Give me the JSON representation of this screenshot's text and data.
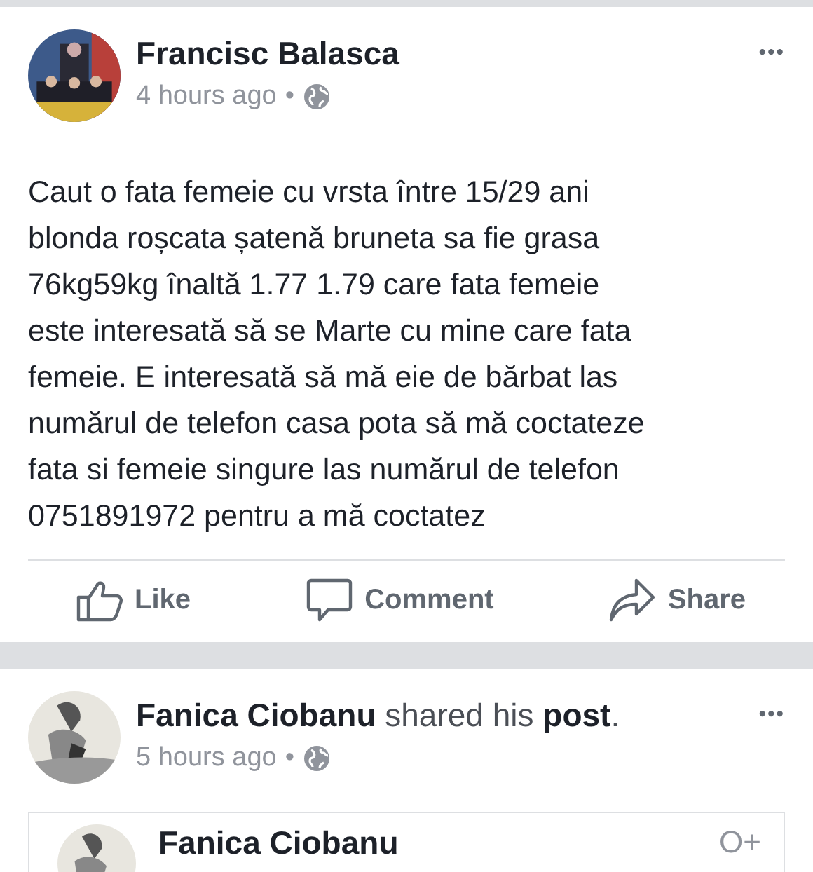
{
  "post": {
    "author": "Francisc Balasca",
    "time": "4 hours ago",
    "separator": "•",
    "menu": "•••",
    "text": "Caut o fata femeie cu vrsta între 15/29 ani\nblonda roșcata șatenă bruneta sa fie grasa\n76kg59kg înaltă 1.77 1.79 care fata femeie\neste interesată să se Marte cu mine care fata\nfemeie. E interesată să mă eie de bărbat las\nnumărul de telefon casa pota să mă coctateze\nfata si femeie singure las numărul de telefon\n0751891972 pentru a mă coctatez",
    "actions": [
      {
        "kind": "like",
        "label": "Like"
      },
      {
        "kind": "comment",
        "label": "Comment"
      },
      {
        "kind": "share",
        "label": "Share"
      }
    ]
  },
  "shared_post": {
    "headline": "**Fanica Ciobanu** shared his **post**.",
    "time": "5 hours ago",
    "separator": "•",
    "menu": "•••",
    "embedded": {
      "author": "Fanica Ciobanu",
      "follow": "O+"
    }
  }
}
